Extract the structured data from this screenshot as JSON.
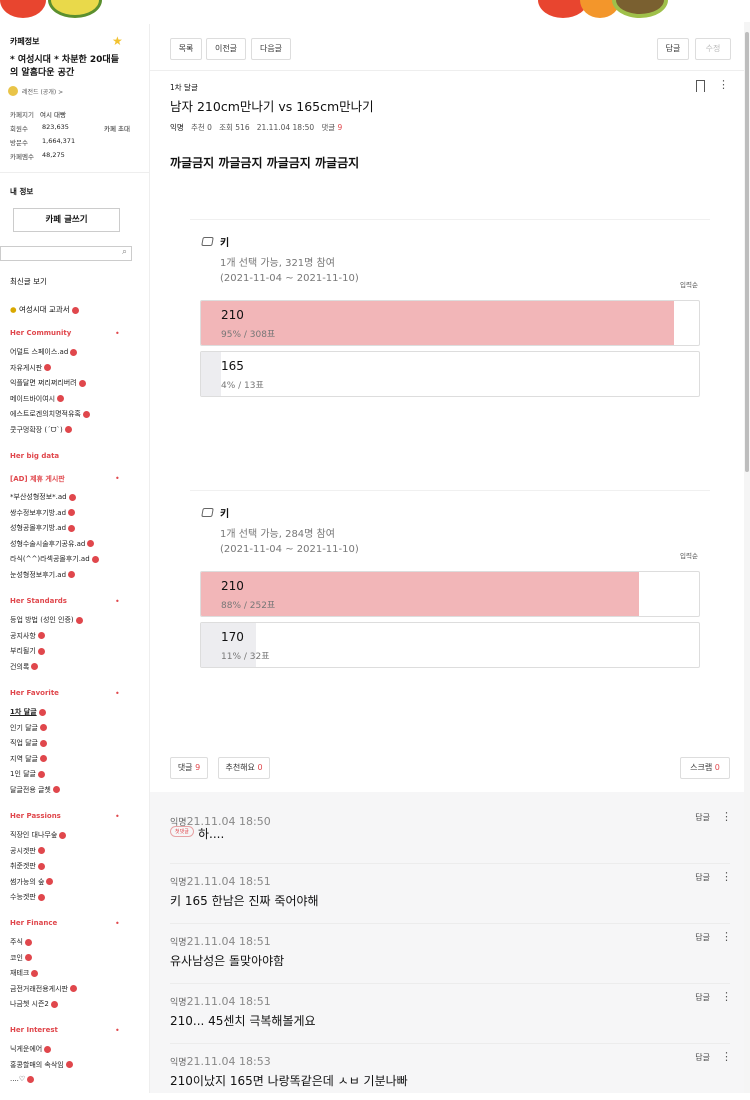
{
  "cafe": {
    "section_title": "카페정보",
    "name": "* 여성시대 * 차분한 20대들의 알흠다운 공간",
    "level": "레전드 (공개)",
    "level_arrow": ">",
    "manager_label": "카페지기",
    "manager_value": "여시 대빵",
    "members_label": "회원수",
    "members_value": "823,635",
    "invite_label": "카페 초대",
    "visitors_label": "방문수",
    "visitors_value": "1,664,371",
    "posts_label": "카페멤수",
    "posts_value": "48,275"
  },
  "myinfo": {
    "label": "내 정보",
    "write_button": "카페 글쓰기"
  },
  "recent": "최신글 보기",
  "textbook": "여성시대 교과서",
  "menu_groups": [
    {
      "title": "Her Community",
      "items": [
        "어덜트 스페이스.ad",
        "자유게시판",
        "익플달면 쩌리쩌리버려",
        "메이드바이여시",
        "에스트로겐의치명적유혹",
        "쿳구멍확장 (ˊᗜˋ)"
      ]
    },
    {
      "title": "Her big data",
      "items": []
    },
    {
      "title": "[AD] 제휴 게시판",
      "items": [
        "*부산성형정보*.ad",
        "쌍수정보후기방.ad",
        "성형공몰후기방.ad",
        "성형수술시술후기공유.ad",
        "라식(^^)라섹공몰후기.ad",
        "눈성형정보후기.ad"
      ]
    },
    {
      "title": "Her Standards",
      "items": [
        "등업 방법 (성인 인증)",
        "공지사항",
        "부리될기",
        "건의록"
      ]
    },
    {
      "title": "Her Favorite",
      "items": [
        "1차 달글",
        "인기 달글",
        "직업 달글",
        "지역 달글",
        "1인 달글",
        "달글전용 글쳇"
      ]
    },
    {
      "title": "Her Passions",
      "items": [
        "직장인 대나무숲",
        "공시겟판",
        "취준겟판",
        "썸가능의 숲",
        "수능겟판"
      ]
    },
    {
      "title": "Her Finance",
      "items": [
        "주식",
        "코인",
        "재테크",
        "금전거래전용게시판",
        "나금쳇 시즌2"
      ]
    },
    {
      "title": "Her Interest",
      "items": [
        "닉게운에어",
        "홍콩할매의 속삭임",
        "....♡"
      ]
    }
  ],
  "toolbar": {
    "list": "목록",
    "prev": "이전글",
    "next": "다음글",
    "reply": "답글",
    "edit": "수정"
  },
  "post": {
    "board": "1차 달글",
    "title": "남자 210cm만나기 vs 165cm만나기",
    "author": "익명",
    "likes": "추천 0",
    "views": "조회 516",
    "date": "21.11.04 18:50",
    "comments_label": "댓글",
    "comments_count": "9",
    "body": "까글금지 까글금지 까글금지 까글금지"
  },
  "polls": [
    {
      "title": "키",
      "desc": "1개 선택 가능, 321명 참여",
      "period": "(2021-11-04 ~ 2021-11-10)",
      "sort": "입력순",
      "options": [
        {
          "label": "210",
          "meta": "95% / 308표",
          "fraction": 0.95,
          "top": true
        },
        {
          "label": "165",
          "meta": "4% / 13표",
          "fraction": 0.04,
          "top": false
        }
      ]
    },
    {
      "title": "키",
      "desc": "1개 선택 가능, 284명 참여",
      "period": "(2021-11-04 ~ 2021-11-10)",
      "sort": "입력순",
      "options": [
        {
          "label": "210",
          "meta": "88% / 252표",
          "fraction": 0.88,
          "top": true
        },
        {
          "label": "170",
          "meta": "11% / 32표",
          "fraction": 0.11,
          "top": false
        }
      ]
    }
  ],
  "actions": {
    "comment": "댓글",
    "comment_count": "9",
    "like": "추천해요",
    "like_count": "0",
    "scrap": "스크랩",
    "scrap_count": "0"
  },
  "comments": [
    {
      "author": "익명",
      "date": "21.11.04 18:50",
      "badge": "첫댓글",
      "text": "하....",
      "reply": "답글"
    },
    {
      "author": "익명",
      "date": "21.11.04 18:51",
      "text": "키 165 한남은 진짜 죽어야해",
      "reply": "답글"
    },
    {
      "author": "익명",
      "date": "21.11.04 18:51",
      "text": "유사남성은 돌맞아야함",
      "reply": "답글"
    },
    {
      "author": "익명",
      "date": "21.11.04 18:51",
      "text": "210... 45센치 극복해볼게요",
      "reply": "답글"
    },
    {
      "author": "익명",
      "date": "21.11.04 18:53",
      "text": "210이났지 165면 나랑똑같은데 ㅅㅂ 기분나빠",
      "reply": "답글"
    }
  ],
  "colors": {
    "accent": "#e0474c",
    "poll_top": "#f2b6b8",
    "poll_low": "#ededf0",
    "comment_bg": "#f6f6f7"
  }
}
